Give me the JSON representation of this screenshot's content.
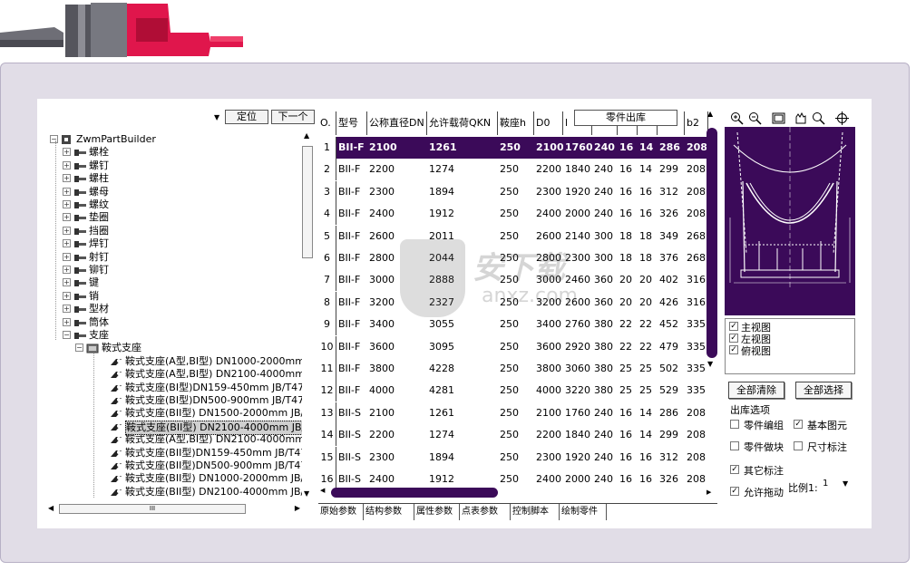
{
  "toolbar": {
    "locate_label": "定位",
    "next_label": "下一个",
    "export_label": "零件出库"
  },
  "tree": {
    "root": "ZwmPartBuilder",
    "categories": [
      "螺栓",
      "螺钉",
      "螺柱",
      "螺母",
      "螺纹",
      "垫圈",
      "挡圈",
      "焊钉",
      "射钉",
      "铆钉",
      "键",
      "销",
      "型材",
      "筒体",
      "支座"
    ],
    "subgroup": "鞍式支座",
    "items": [
      "鞍式支座(A型,BI型) DN1000-2000mm JB/T-",
      "鞍式支座(A型,BI型) DN2100-4000mm JB/T-",
      "鞍式支座(BI型)DN159-450mm JB/T4712-19",
      "鞍式支座(BI型)DN500-900mm JB/T4712-19",
      "鞍式支座(BII型) DN1500-2000mm JB/T4712",
      "鞍式支座(BII型) DN2100-4000mm JB/T4712",
      "鞍式支座(A型,BI型) DN2100-4000mm JB/T-",
      "鞍式支座(BII型)DN159-450mm JB/T4712.1-",
      "鞍式支座(BII型)DN500-900mm JB/T4712.1-",
      "鞍式支座(BII型) DN1000-2000mm JB/T4712",
      "鞍式支座(BII型) DN2100-4000mm JB/T4712",
      "鞍式支座(A型,BI型) DN1000-2000mm JB/T-"
    ],
    "selected_index": 5,
    "hscroll_label": "III"
  },
  "table": {
    "columns": [
      "O.",
      "型号",
      "公称直径DN",
      "允许载荷QKN",
      "鞍座h",
      "D0",
      "l",
      "",
      "",
      "",
      "",
      "b2"
    ],
    "rows": [
      [
        "1",
        "BII-F",
        "2100",
        "1261",
        "250",
        "2100",
        "1760",
        "240",
        "16",
        "14",
        "286",
        "208"
      ],
      [
        "2",
        "BII-F",
        "2200",
        "1274",
        "250",
        "2200",
        "1840",
        "240",
        "16",
        "14",
        "299",
        "208"
      ],
      [
        "3",
        "BII-F",
        "2300",
        "1894",
        "250",
        "2300",
        "1920",
        "240",
        "16",
        "16",
        "312",
        "208"
      ],
      [
        "4",
        "BII-F",
        "2400",
        "1912",
        "250",
        "2400",
        "2000",
        "240",
        "16",
        "16",
        "326",
        "208"
      ],
      [
        "5",
        "BII-F",
        "2600",
        "2011",
        "250",
        "2600",
        "2140",
        "300",
        "18",
        "18",
        "349",
        "268"
      ],
      [
        "6",
        "BII-F",
        "2800",
        "2044",
        "250",
        "2800",
        "2300",
        "300",
        "18",
        "18",
        "376",
        "268"
      ],
      [
        "7",
        "BII-F",
        "3000",
        "2888",
        "250",
        "3000",
        "2460",
        "360",
        "20",
        "20",
        "402",
        "316"
      ],
      [
        "8",
        "BII-F",
        "3200",
        "2327",
        "250",
        "3200",
        "2600",
        "360",
        "20",
        "20",
        "426",
        "316"
      ],
      [
        "9",
        "BII-F",
        "3400",
        "3055",
        "250",
        "3400",
        "2760",
        "380",
        "22",
        "22",
        "452",
        "335"
      ],
      [
        "10",
        "BII-F",
        "3600",
        "3095",
        "250",
        "3600",
        "2920",
        "380",
        "22",
        "22",
        "479",
        "335"
      ],
      [
        "11",
        "BII-F",
        "3800",
        "4228",
        "250",
        "3800",
        "3060",
        "380",
        "25",
        "25",
        "502",
        "335"
      ],
      [
        "12",
        "BII-F",
        "4000",
        "4281",
        "250",
        "4000",
        "3220",
        "380",
        "25",
        "25",
        "529",
        "335"
      ],
      [
        "13",
        "BII-S",
        "2100",
        "1261",
        "250",
        "2100",
        "1760",
        "240",
        "16",
        "14",
        "286",
        "208"
      ],
      [
        "14",
        "BII-S",
        "2200",
        "1274",
        "250",
        "2200",
        "1840",
        "240",
        "16",
        "14",
        "299",
        "208"
      ],
      [
        "15",
        "BII-S",
        "2300",
        "1894",
        "250",
        "2300",
        "1920",
        "240",
        "16",
        "16",
        "312",
        "208"
      ],
      [
        "16",
        "BII-S",
        "2400",
        "1912",
        "250",
        "2400",
        "2000",
        "240",
        "16",
        "16",
        "326",
        "208"
      ]
    ],
    "selected_row": 0,
    "tabs": [
      "原始参数",
      "结构参数",
      "属性参数",
      "点表参数",
      "控制脚本",
      "绘制零件"
    ]
  },
  "views": [
    {
      "label": "主视图",
      "checked": true
    },
    {
      "label": "左视图",
      "checked": true
    },
    {
      "label": "俯视图",
      "checked": true
    }
  ],
  "buttons": {
    "clear_all": "全部清除",
    "select_all": "全部选择"
  },
  "options": {
    "title": "出库选项",
    "items": [
      {
        "label": "零件编组",
        "checked": false
      },
      {
        "label": "基本图元",
        "checked": true
      },
      {
        "label": "零件做块",
        "checked": false
      },
      {
        "label": "尺寸标注",
        "checked": false
      },
      {
        "label": "其它标注",
        "checked": true
      },
      {
        "label": "允许拖动",
        "checked": true
      }
    ],
    "scale_label": "比例1:",
    "scale_value": "1"
  },
  "watermark": {
    "text": "安下载",
    "sub": "anxz.com"
  },
  "colors": {
    "accent": "#3b0a59",
    "frame": "#e1dde7"
  }
}
